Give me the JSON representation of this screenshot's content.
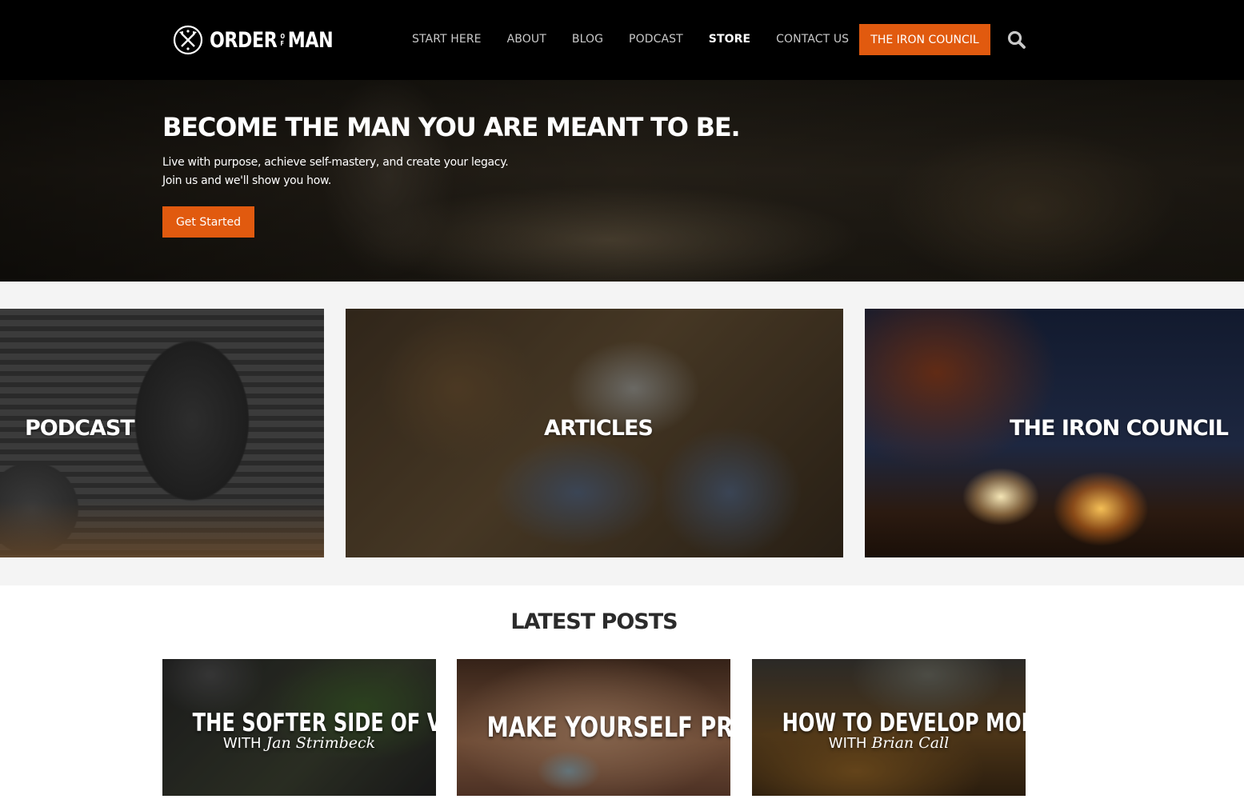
{
  "brand": {
    "name_left": "ORDER",
    "name_of_top": "O",
    "name_of_bottom": "F",
    "name_right": "MAN",
    "accent_color": "#e15a0f"
  },
  "nav": {
    "items": [
      {
        "label": "START HERE"
      },
      {
        "label": "ABOUT"
      },
      {
        "label": "BLOG"
      },
      {
        "label": "PODCAST"
      },
      {
        "label": "STORE",
        "active": true
      },
      {
        "label": "CONTACT US"
      }
    ],
    "cta_label": "THE IRON COUNCIL",
    "search_icon": "search-icon"
  },
  "hero": {
    "title": "BECOME THE MAN YOU ARE MEANT TO BE.",
    "subtitle_line1": "Live with purpose, achieve self-mastery, and create your legacy.",
    "subtitle_line2": "Join us and we'll show you how.",
    "button_label": "Get Started"
  },
  "features": [
    {
      "label": "PODCAST"
    },
    {
      "label": "ARTICLES"
    },
    {
      "label": "THE IRON COUNCIL"
    }
  ],
  "latest_posts": {
    "heading": "LATEST POSTS",
    "posts": [
      {
        "title": "THE SOFTER SIDE OF VIOLENCE",
        "with": "WITH",
        "guest": "Jan Strimbeck"
      },
      {
        "title": "MAKE YOURSELF PROUD",
        "with": "",
        "guest": ""
      },
      {
        "title": "HOW TO DEVELOP MORE GRIT",
        "with": "WITH",
        "guest": "Brian Call"
      }
    ]
  }
}
